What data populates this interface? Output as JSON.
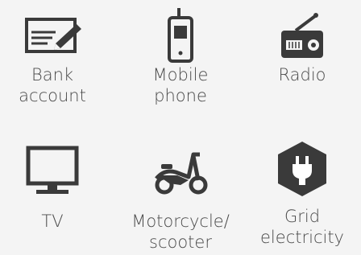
{
  "items": [
    {
      "icon": "cheque-pen-icon",
      "label_line1": "Bank",
      "label_line2": "account"
    },
    {
      "icon": "mobile-phone-icon",
      "label_line1": "Mobile",
      "label_line2": "phone"
    },
    {
      "icon": "radio-icon",
      "label_line1": "Radio",
      "label_line2": ""
    },
    {
      "icon": "tv-monitor-icon",
      "label_line1": "TV",
      "label_line2": ""
    },
    {
      "icon": "scooter-icon",
      "label_line1": "Motorcycle/",
      "label_line2": "scooter"
    },
    {
      "icon": "plug-hexagon-icon",
      "label_line1": "Grid",
      "label_line2": "electricity"
    }
  ],
  "colors": {
    "icon": "#3a3a3a",
    "background": "#f4f4f4",
    "text": "#4a4a4a"
  }
}
